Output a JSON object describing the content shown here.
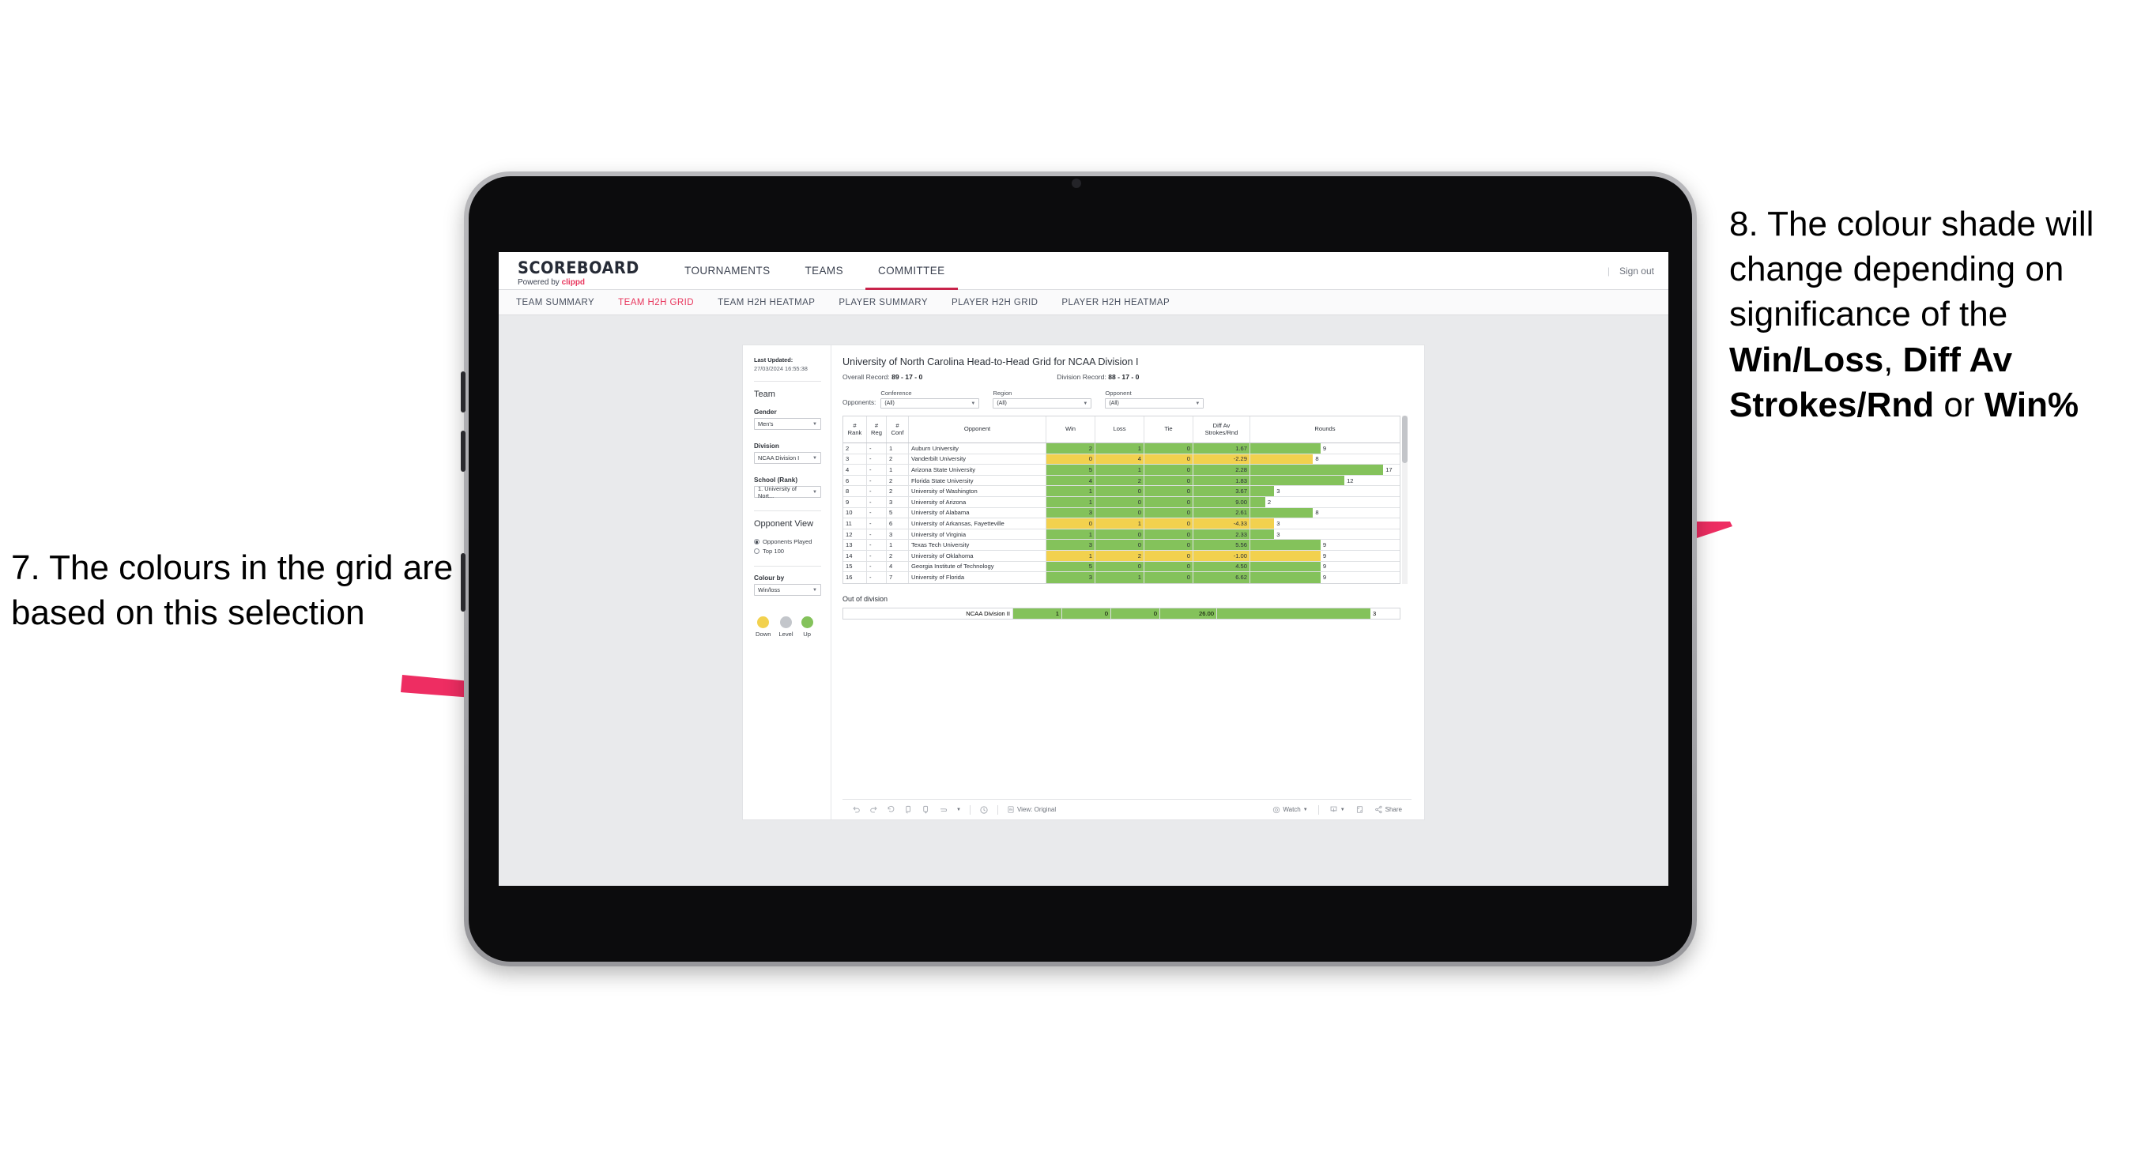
{
  "annotations": {
    "left": "7. The colours in the grid are based on this selection",
    "right_pre": "8. The colour shade will change depending on significance of the ",
    "right_b1": "Win/Loss",
    "right_mid1": ", ",
    "right_b2": "Diff Av Strokes/Rnd",
    "right_mid2": " or ",
    "right_b3": "Win%",
    "arrow_color": "#ee2d62"
  },
  "app": {
    "brand": {
      "title": "SCOREBOARD",
      "powered_prefix": "Powered by ",
      "powered_name": "clippd"
    },
    "nav": [
      {
        "label": "TOURNAMENTS",
        "active": false
      },
      {
        "label": "TEAMS",
        "active": false
      },
      {
        "label": "COMMITTEE",
        "active": true
      }
    ],
    "topbar_right": {
      "divider": "|",
      "signout": "Sign out"
    },
    "subnav": [
      {
        "label": "TEAM SUMMARY",
        "active": false
      },
      {
        "label": "TEAM H2H GRID",
        "active": true
      },
      {
        "label": "TEAM H2H HEATMAP",
        "active": false
      },
      {
        "label": "PLAYER SUMMARY",
        "active": false
      },
      {
        "label": "PLAYER H2H GRID",
        "active": false
      },
      {
        "label": "PLAYER H2H HEATMAP",
        "active": false
      }
    ]
  },
  "sidebar": {
    "last_updated_label": "Last Updated:",
    "last_updated_value": "27/03/2024 16:55:38",
    "team_heading": "Team",
    "gender_label": "Gender",
    "gender_value": "Men's",
    "division_label": "Division",
    "division_value": "NCAA Division I",
    "school_label": "School (Rank)",
    "school_value": "1. University of Nort...",
    "opponent_view_heading": "Opponent View",
    "opponent_view_options": [
      {
        "label": "Opponents Played",
        "selected": true
      },
      {
        "label": "Top 100",
        "selected": false
      }
    ],
    "colour_by_label": "Colour by",
    "colour_by_value": "Win/loss",
    "legend": [
      {
        "label": "Down",
        "color": "#f2d14e"
      },
      {
        "label": "Level",
        "color": "#c3c6cb"
      },
      {
        "label": "Up",
        "color": "#84c25b"
      }
    ]
  },
  "main": {
    "title": "University of North Carolina Head-to-Head Grid for NCAA Division I",
    "overall_record_label": "Overall Record:",
    "overall_record_value": "89 - 17 - 0",
    "division_record_label": "Division Record:",
    "division_record_value": "88 - 17 - 0",
    "opponents_label": "Opponents:",
    "filters": [
      {
        "label": "Conference",
        "value": "(All)"
      },
      {
        "label": "Region",
        "value": "(All)"
      },
      {
        "label": "Opponent",
        "value": "(All)"
      }
    ],
    "columns": [
      "# Rank",
      "# Reg",
      "# Conf",
      "Opponent",
      "Win",
      "Loss",
      "Tie",
      "Diff Av Strokes/Rnd",
      "Rounds"
    ],
    "rows": [
      {
        "rank": "2",
        "reg": "-",
        "conf": "1",
        "opponent": "Auburn University",
        "win": "2",
        "loss": "1",
        "tie": "0",
        "diff": "1.67",
        "rounds": "9",
        "color": "#84c25b",
        "bar_pct": 47
      },
      {
        "rank": "3",
        "reg": "-",
        "conf": "2",
        "opponent": "Vanderbilt University",
        "win": "0",
        "loss": "4",
        "tie": "0",
        "diff": "-2.29",
        "rounds": "8",
        "color": "#f2d14e",
        "bar_pct": 42
      },
      {
        "rank": "4",
        "reg": "-",
        "conf": "1",
        "opponent": "Arizona State University",
        "win": "5",
        "loss": "1",
        "tie": "0",
        "diff": "2.28",
        "rounds": "17",
        "color": "#84c25b",
        "bar_pct": 89
      },
      {
        "rank": "6",
        "reg": "-",
        "conf": "2",
        "opponent": "Florida State University",
        "win": "4",
        "loss": "2",
        "tie": "0",
        "diff": "1.83",
        "rounds": "12",
        "color": "#84c25b",
        "bar_pct": 63
      },
      {
        "rank": "8",
        "reg": "-",
        "conf": "2",
        "opponent": "University of Washington",
        "win": "1",
        "loss": "0",
        "tie": "0",
        "diff": "3.67",
        "rounds": "3",
        "color": "#84c25b",
        "bar_pct": 16
      },
      {
        "rank": "9",
        "reg": "-",
        "conf": "3",
        "opponent": "University of Arizona",
        "win": "1",
        "loss": "0",
        "tie": "0",
        "diff": "9.00",
        "rounds": "2",
        "color": "#84c25b",
        "bar_pct": 10
      },
      {
        "rank": "10",
        "reg": "-",
        "conf": "5",
        "opponent": "University of Alabama",
        "win": "3",
        "loss": "0",
        "tie": "0",
        "diff": "2.61",
        "rounds": "8",
        "color": "#84c25b",
        "bar_pct": 42
      },
      {
        "rank": "11",
        "reg": "-",
        "conf": "6",
        "opponent": "University of Arkansas, Fayetteville",
        "win": "0",
        "loss": "1",
        "tie": "0",
        "diff": "-4.33",
        "rounds": "3",
        "color": "#f2d14e",
        "bar_pct": 16
      },
      {
        "rank": "12",
        "reg": "-",
        "conf": "3",
        "opponent": "University of Virginia",
        "win": "1",
        "loss": "0",
        "tie": "0",
        "diff": "2.33",
        "rounds": "3",
        "color": "#84c25b",
        "bar_pct": 16
      },
      {
        "rank": "13",
        "reg": "-",
        "conf": "1",
        "opponent": "Texas Tech University",
        "win": "3",
        "loss": "0",
        "tie": "0",
        "diff": "5.56",
        "rounds": "9",
        "color": "#84c25b",
        "bar_pct": 47
      },
      {
        "rank": "14",
        "reg": "-",
        "conf": "2",
        "opponent": "University of Oklahoma",
        "win": "1",
        "loss": "2",
        "tie": "0",
        "diff": "-1.00",
        "rounds": "9",
        "color": "#f2d14e",
        "bar_pct": 47
      },
      {
        "rank": "15",
        "reg": "-",
        "conf": "4",
        "opponent": "Georgia Institute of Technology",
        "win": "5",
        "loss": "0",
        "tie": "0",
        "diff": "4.50",
        "rounds": "9",
        "color": "#84c25b",
        "bar_pct": 47
      },
      {
        "rank": "16",
        "reg": "-",
        "conf": "7",
        "opponent": "University of Florida",
        "win": "3",
        "loss": "1",
        "tie": "0",
        "diff": "6.62",
        "rounds": "9",
        "color": "#84c25b",
        "bar_pct": 47
      }
    ],
    "out_of_division_title": "Out of division",
    "out_of_division_row": {
      "name": "NCAA Division II",
      "win": "1",
      "loss": "0",
      "tie": "0",
      "diff": "26.00",
      "rounds": "3",
      "color": "#84c25b",
      "bar_pct": 84
    }
  },
  "toolbar": {
    "left_icons": [
      "undo-icon",
      "redo-icon",
      "revert-icon",
      "refresh-icon",
      "pause-icon",
      "swap-icon",
      "chevron-down-icon",
      "clock-icon"
    ],
    "view_label": "View: Original",
    "watch_label": "Watch",
    "share_label": "Share"
  }
}
